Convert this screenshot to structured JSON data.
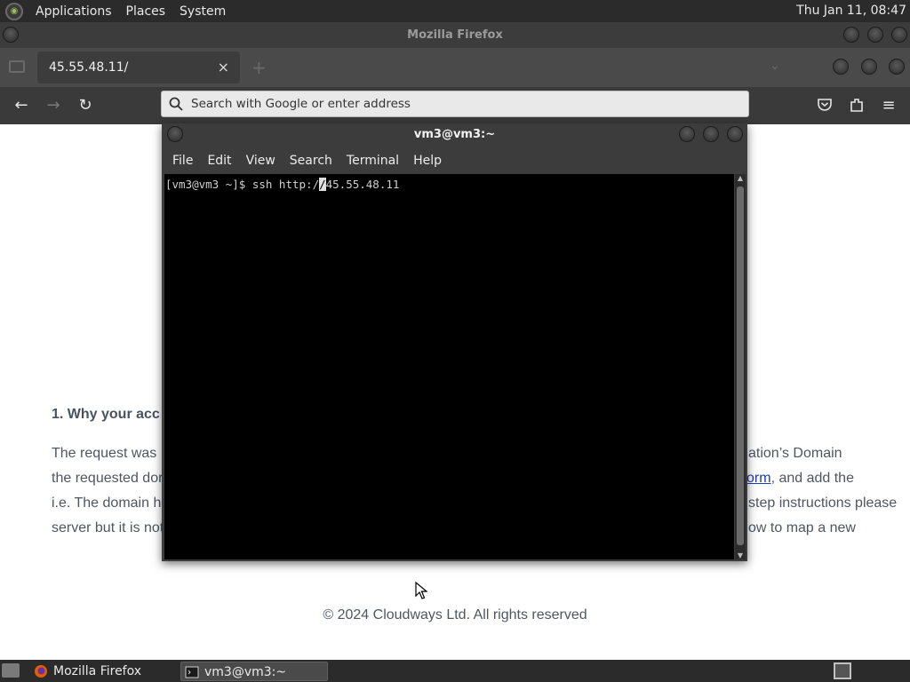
{
  "top_panel": {
    "menus": [
      "Applications",
      "Places",
      "System"
    ],
    "clock": "Thu Jan 11, 08:47"
  },
  "firefox": {
    "window_title": "Mozilla Firefox",
    "tab_title": "45.55.48.11/",
    "tab_close": "×",
    "new_tab": "+",
    "url_placeholder": "Search with Google or enter address"
  },
  "page": {
    "heading": "1. Why your acc",
    "left_lines": [
      "The request was",
      "the requested dor",
      "i.e. The domain h",
      "server but it is not"
    ],
    "right_lines": [
      {
        "text": "ation’s Domain"
      },
      {
        "link": "orm",
        "text": ", and add the"
      },
      {
        "text": "step instructions please"
      },
      {
        "text": "ow to map a new"
      }
    ],
    "footer": "© 2024 Cloudways Ltd. All rights reserved"
  },
  "terminal": {
    "title": "vm3@vm3:~",
    "menus": [
      "File",
      "Edit",
      "View",
      "Search",
      "Terminal",
      "Help"
    ],
    "line_before_cursor": "[vm3@vm3 ~]$ ssh http:/",
    "cursor_char": "/",
    "line_after_cursor": "45.55.48.11"
  },
  "taskbar": {
    "items": [
      "Mozilla Firefox",
      "vm3@vm3:~"
    ]
  }
}
